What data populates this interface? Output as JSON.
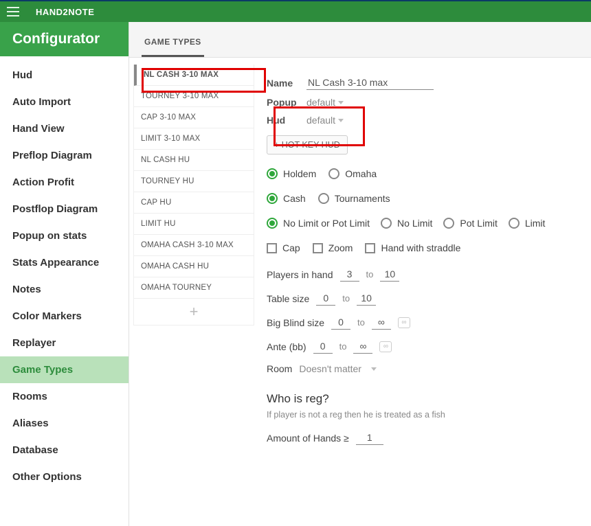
{
  "app": {
    "name": "HAND2NOTE"
  },
  "sidebar": {
    "title": "Configurator",
    "items": [
      {
        "label": "Hud"
      },
      {
        "label": "Auto Import"
      },
      {
        "label": "Hand View"
      },
      {
        "label": "Preflop Diagram"
      },
      {
        "label": "Action Profit"
      },
      {
        "label": "Postflop Diagram"
      },
      {
        "label": "Popup on stats"
      },
      {
        "label": "Stats Appearance"
      },
      {
        "label": "Notes"
      },
      {
        "label": "Color Markers"
      },
      {
        "label": "Replayer"
      },
      {
        "label": "Game Types",
        "active": true
      },
      {
        "label": "Rooms"
      },
      {
        "label": "Aliases"
      },
      {
        "label": "Database"
      },
      {
        "label": "Other Options"
      }
    ]
  },
  "tabs": {
    "active": "GAME TYPES"
  },
  "game_list": [
    {
      "label": "NL CASH 3-10 MAX",
      "selected": true
    },
    {
      "label": "TOURNEY 3-10 MAX"
    },
    {
      "label": "CAP 3-10 MAX"
    },
    {
      "label": "LIMIT 3-10 MAX"
    },
    {
      "label": "NL CASH HU"
    },
    {
      "label": "TOURNEY HU"
    },
    {
      "label": "CAP HU"
    },
    {
      "label": "LIMIT HU"
    },
    {
      "label": "OMAHA CASH 3-10 MAX"
    },
    {
      "label": "OMAHA CASH HU"
    },
    {
      "label": "OMAHA TOURNEY"
    }
  ],
  "detail": {
    "name_label": "Name",
    "name_value": "NL Cash 3-10 max",
    "popup_label": "Popup",
    "popup_value": "default",
    "hud_label": "Hud",
    "hud_value": "default",
    "hotkey_btn": "+ HOT KEY HUD",
    "game_variant": {
      "options": [
        "Holdem",
        "Omaha"
      ],
      "selected": 0
    },
    "format": {
      "options": [
        "Cash",
        "Tournaments"
      ],
      "selected": 0
    },
    "limit": {
      "options": [
        "No Limit or Pot Limit",
        "No Limit",
        "Pot Limit",
        "Limit"
      ],
      "selected": 0
    },
    "flags": {
      "options": [
        "Cap",
        "Zoom",
        "Hand with straddle"
      ]
    },
    "players": {
      "label": "Players in hand",
      "from": "3",
      "to": "10"
    },
    "tablesize": {
      "label": "Table size",
      "from": "0",
      "to": "10"
    },
    "bb": {
      "label": "Big Blind size",
      "from": "0",
      "to": "∞"
    },
    "ante": {
      "label": "Ante (bb)",
      "from": "0",
      "to": "∞"
    },
    "room": {
      "label": "Room",
      "value": "Doesn't matter"
    },
    "reg": {
      "heading": "Who is reg?",
      "hint": "If player is not a reg then he is treated as a fish",
      "amount_label": "Amount of Hands ≥",
      "amount_value": "1"
    },
    "to_word": "to"
  }
}
